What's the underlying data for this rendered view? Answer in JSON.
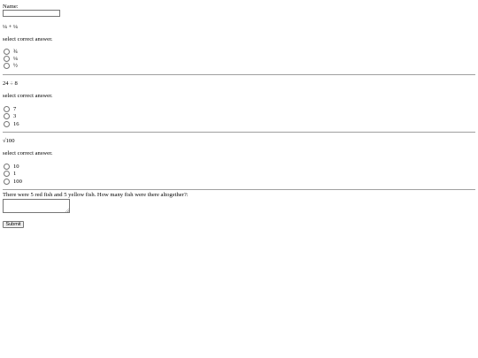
{
  "name_label": "Name:",
  "name_value": "",
  "questions": [
    {
      "text": "¼ + ¼",
      "instruction": "select correct answer.",
      "options": [
        "¾",
        "¼",
        "½"
      ]
    },
    {
      "text": "24 ÷ 8",
      "instruction": "select correct answer.",
      "options": [
        "7",
        "3",
        "16"
      ]
    },
    {
      "text": "√100",
      "instruction": "select correct answer.",
      "options": [
        "10",
        "1",
        "100"
      ]
    }
  ],
  "open_question": {
    "text": "There were 5 red fish and 5 yellow fish. How many fish were there altogether?:",
    "answer_value": ""
  },
  "submit_label": "Submit",
  "colors": {
    "border": "#767676",
    "rule": "#a0a0a0",
    "button_bg": "#efefef"
  }
}
